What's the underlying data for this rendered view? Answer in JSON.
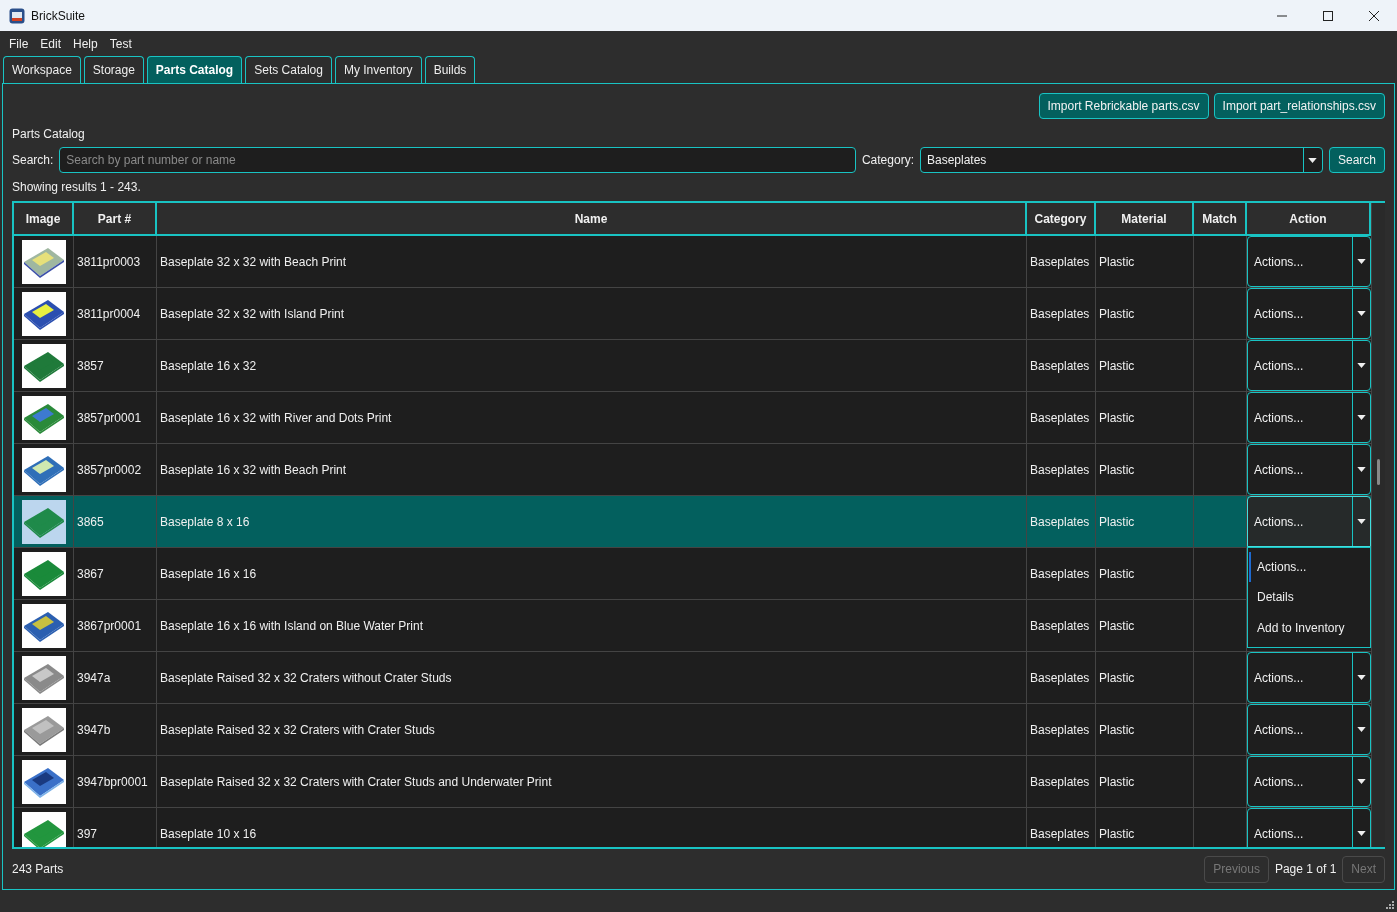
{
  "window": {
    "title": "BrickSuite"
  },
  "menu": [
    "File",
    "Edit",
    "Help",
    "Test"
  ],
  "tabs": [
    {
      "label": "Workspace",
      "selected": false
    },
    {
      "label": "Storage",
      "selected": false
    },
    {
      "label": "Parts Catalog",
      "selected": true
    },
    {
      "label": "Sets Catalog",
      "selected": false
    },
    {
      "label": "My Inventory",
      "selected": false
    },
    {
      "label": "Builds",
      "selected": false
    }
  ],
  "import_buttons": [
    "Import Rebrickable parts.csv",
    "Import part_relationships.csv"
  ],
  "section_title": "Parts Catalog",
  "search": {
    "label": "Search:",
    "placeholder": "Search by part number or name",
    "button": "Search"
  },
  "category": {
    "label": "Category:",
    "value": "Baseplates"
  },
  "results_text": "Showing results 1 - 243.",
  "table": {
    "columns": [
      "Image",
      "Part #",
      "Name",
      "Category",
      "Material",
      "Match",
      "Action"
    ],
    "rows": [
      {
        "part": "3811pr0003",
        "name": "Baseplate 32 x 32 with Beach Print",
        "category": "Baseplates",
        "material": "Plastic",
        "action": "Actions...",
        "selected": false,
        "expanded": false
      },
      {
        "part": "3811pr0004",
        "name": "Baseplate 32 x 32 with Island Print",
        "category": "Baseplates",
        "material": "Plastic",
        "action": "Actions...",
        "selected": false,
        "expanded": false
      },
      {
        "part": "3857",
        "name": "Baseplate 16 x 32",
        "category": "Baseplates",
        "material": "Plastic",
        "action": "Actions...",
        "selected": false,
        "expanded": false
      },
      {
        "part": "3857pr0001",
        "name": "Baseplate 16 x 32 with River and Dots Print",
        "category": "Baseplates",
        "material": "Plastic",
        "action": "Actions...",
        "selected": false,
        "expanded": false
      },
      {
        "part": "3857pr0002",
        "name": "Baseplate 16 x 32 with Beach Print",
        "category": "Baseplates",
        "material": "Plastic",
        "action": "Actions...",
        "selected": false,
        "expanded": false
      },
      {
        "part": "3865",
        "name": "Baseplate 8 x 16",
        "category": "Baseplates",
        "material": "Plastic",
        "action": "Actions...",
        "selected": true,
        "expanded": true
      },
      {
        "part": "3867",
        "name": "Baseplate 16 x 16",
        "category": "Baseplates",
        "material": "Plastic",
        "selected": false,
        "expanded": false
      },
      {
        "part": "3867pr0001",
        "name": "Baseplate 16 x 16 with Island on Blue Water Print",
        "category": "Baseplates",
        "material": "Plastic",
        "selected": false,
        "expanded": false
      },
      {
        "part": "3947a",
        "name": "Baseplate Raised 32 x 32 Craters without Crater Studs",
        "category": "Baseplates",
        "material": "Plastic",
        "action": "Actions...",
        "selected": false,
        "expanded": false
      },
      {
        "part": "3947b",
        "name": "Baseplate Raised 32 x 32 Craters with Crater Studs",
        "category": "Baseplates",
        "material": "Plastic",
        "action": "Actions...",
        "selected": false,
        "expanded": false
      },
      {
        "part": "3947bpr0001",
        "name": "Baseplate Raised 32 x 32 Craters with Crater Studs and Underwater Print",
        "category": "Baseplates",
        "material": "Plastic",
        "action": "Actions...",
        "selected": false,
        "expanded": false
      },
      {
        "part": "397",
        "name": "Baseplate 10 x 16",
        "category": "Baseplates",
        "material": "Plastic",
        "action": "Actions...",
        "selected": false,
        "expanded": false
      }
    ]
  },
  "action_menu": [
    {
      "label": "Actions...",
      "selected": true
    },
    {
      "label": "Details",
      "selected": false
    },
    {
      "label": "Add to Inventory",
      "selected": false
    }
  ],
  "footer": {
    "count": "243 Parts",
    "previous": {
      "label": "Previous",
      "disabled": true
    },
    "page": "Page 1 of 1",
    "next": {
      "label": "Next",
      "disabled": true
    }
  }
}
